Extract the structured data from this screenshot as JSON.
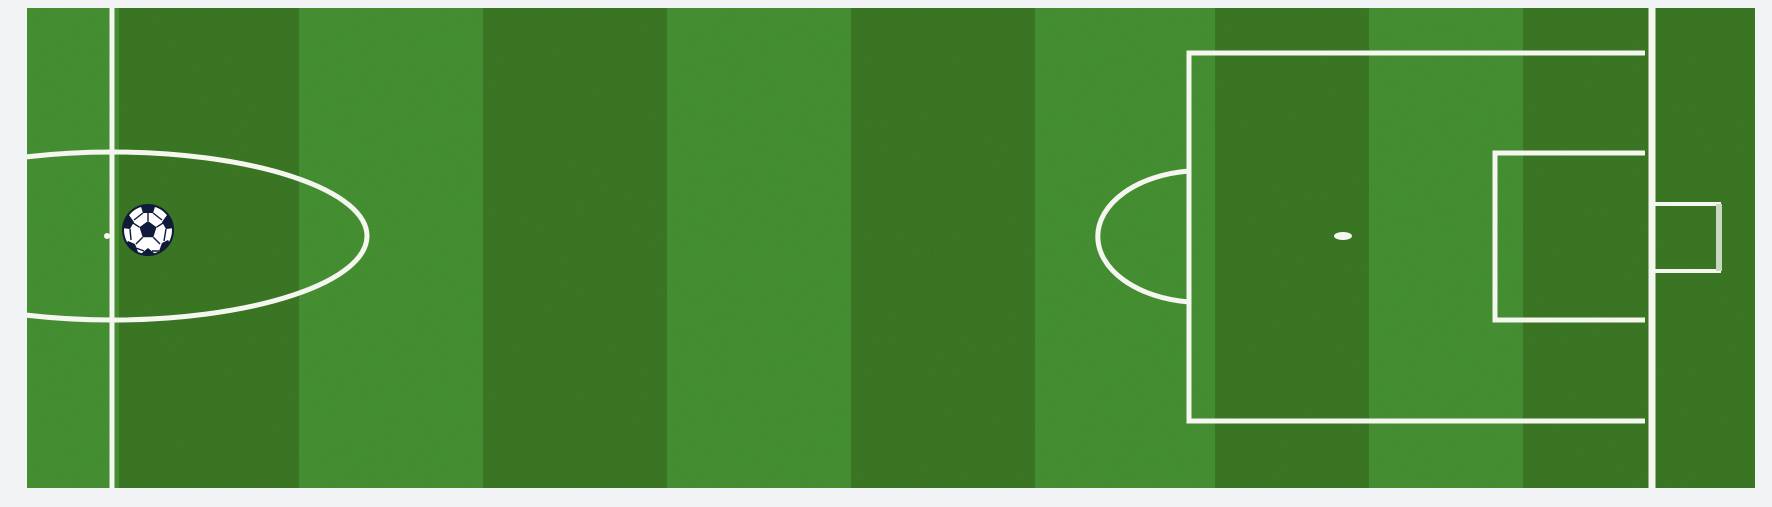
{
  "game": {
    "scene": "soccer-field",
    "colors": {
      "background": "#f2f3f5",
      "grass_dark": "#3f7f27",
      "grass_light": "#4a9a36",
      "line": "#f4f6ef",
      "ball_black": "#101a3a",
      "ball_white": "#ffffff"
    },
    "elements": {
      "halfway_line": "halfway-line",
      "center_circle": "center-circle",
      "penalty_area": "penalty-area",
      "goal_area": "goal-area",
      "penalty_spot": "penalty-spot",
      "penalty_arc": "penalty-arc",
      "goal_line": "goal-line",
      "goal": "goal",
      "ball": "soccer-ball-icon"
    }
  }
}
